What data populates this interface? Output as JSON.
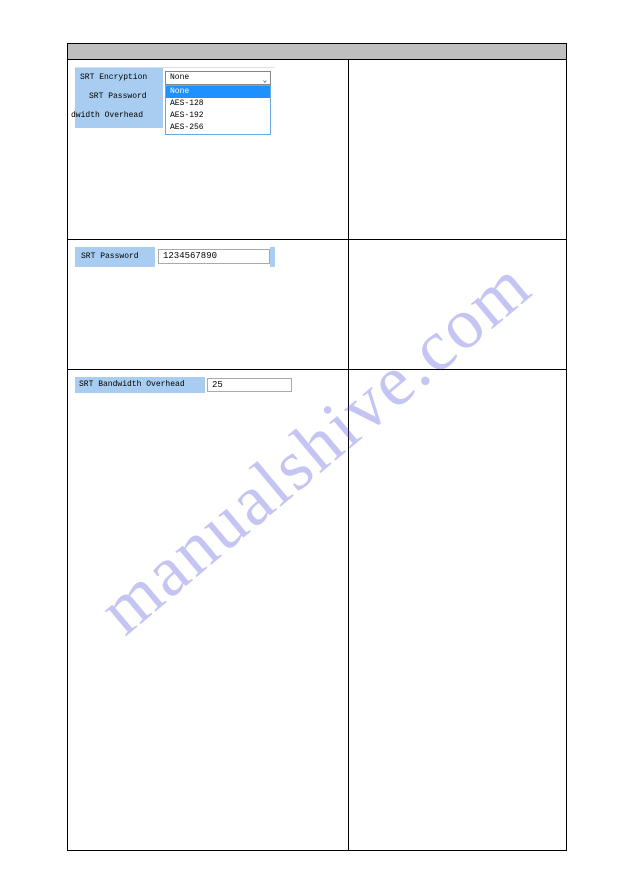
{
  "watermark": "manualshive.com",
  "row1": {
    "label_encryption": "SRT Encryption",
    "label_password": "SRT Password",
    "label_bandwidth": "dwidth Overhead",
    "select_value": "None",
    "options": {
      "opt0": "None",
      "opt1": "AES-128",
      "opt2": "AES-192",
      "opt3": "AES-256"
    }
  },
  "row2": {
    "label": "SRT Password",
    "value": "1234567890"
  },
  "row3": {
    "label": "SRT Bandwidth Overhead",
    "value": "25"
  }
}
